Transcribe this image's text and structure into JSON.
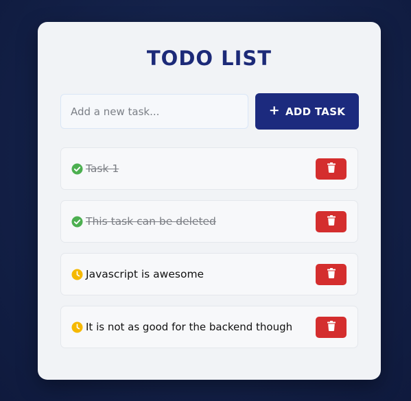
{
  "app": {
    "title": "TODO LIST"
  },
  "new_task": {
    "placeholder": "Add a new task...",
    "value": ""
  },
  "add_button": {
    "icon": "plus-icon",
    "label": "ADD TASK"
  },
  "tasks": [
    {
      "text": "Task 1",
      "completed": true,
      "status_icon": "check-circle-icon"
    },
    {
      "text": "This task can be deleted",
      "completed": true,
      "status_icon": "check-circle-icon"
    },
    {
      "text": "Javascript is awesome",
      "completed": false,
      "status_icon": "clock-icon"
    },
    {
      "text": "It is not as good for the backend though",
      "completed": false,
      "status_icon": "clock-icon"
    }
  ],
  "delete_icon": "trash-icon",
  "colors": {
    "title": "#1c2a78",
    "primary_button": "#1c2a7e",
    "delete_button": "#d42e2e",
    "completed_icon": "#4caf50",
    "pending_icon": "#f5b800"
  }
}
